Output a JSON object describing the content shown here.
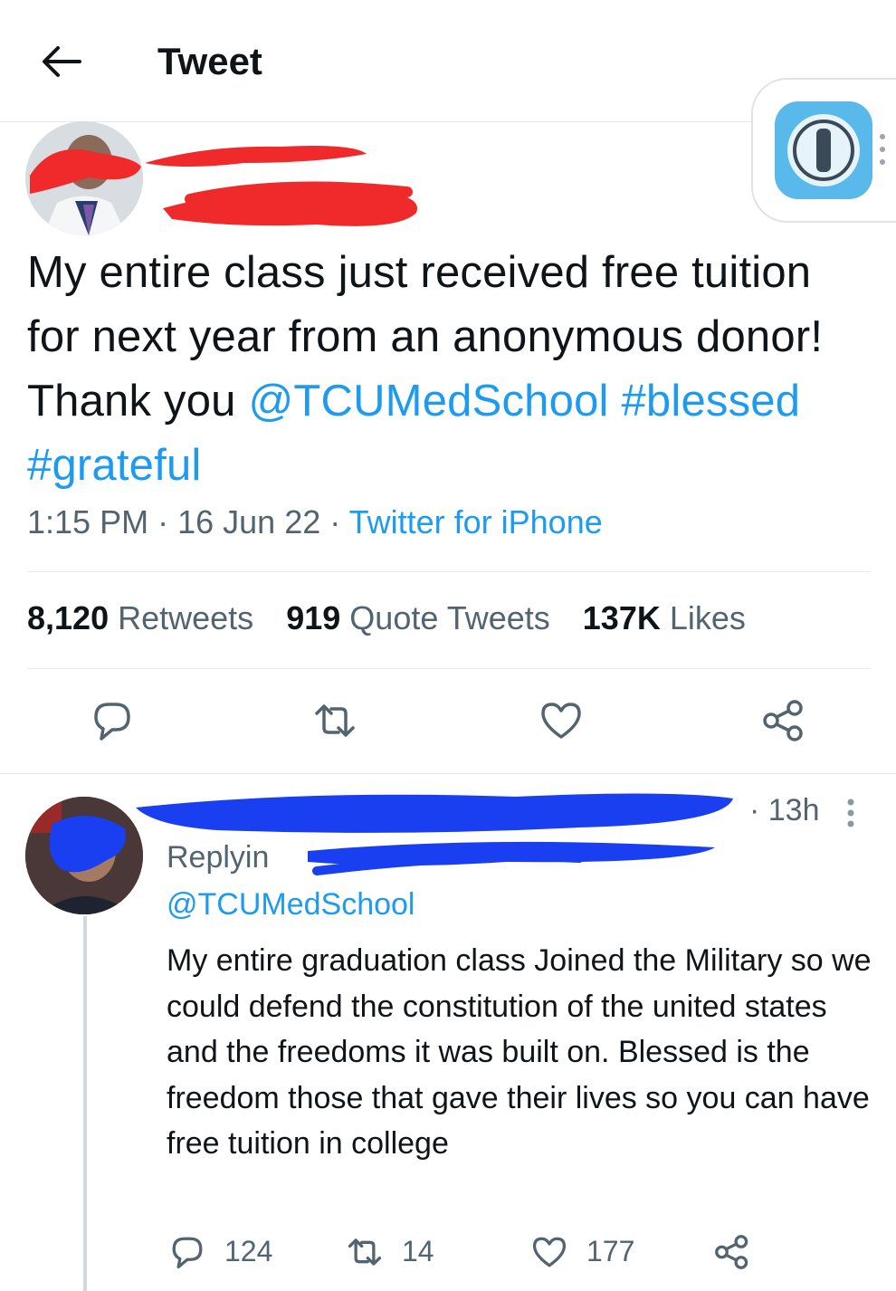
{
  "header": {
    "title": "Tweet"
  },
  "tweet": {
    "text_plain": "My entire class just received free tuition for next year from an anonymous donor! Thank you",
    "mention": "@TCUMedSchool",
    "hashtag1": "#blessed",
    "hashtag2": "#grateful",
    "time": "1:15 PM",
    "sep1": "·",
    "date": "16 Jun 22",
    "sep2": "·",
    "source": "Twitter for iPhone",
    "retweets_count": "8,120",
    "retweets_label": "Retweets",
    "quotes_count": "919",
    "quotes_label": "Quote Tweets",
    "likes_count": "137K",
    "likes_label": "Likes"
  },
  "reply": {
    "time": "· 13h",
    "replying_label": "Replyin",
    "mention": "@TCUMedSchool",
    "text": "My entire graduation class Joined the Military so we could defend the constitution of the united states and the freedoms it was built on. Blessed is the freedom those that gave their lives so you can have free tuition in college",
    "reply_count": "124",
    "retweet_count": "14",
    "like_count": "177"
  },
  "colors": {
    "accent": "#1d9bf0",
    "redaction_red": "#f02a2a",
    "redaction_blue": "#1a3ff0",
    "secondary": "#536471"
  },
  "icons": [
    "back-arrow-icon",
    "password-manager-icon",
    "reply-icon",
    "retweet-icon",
    "like-icon",
    "share-icon",
    "more-icon"
  ]
}
